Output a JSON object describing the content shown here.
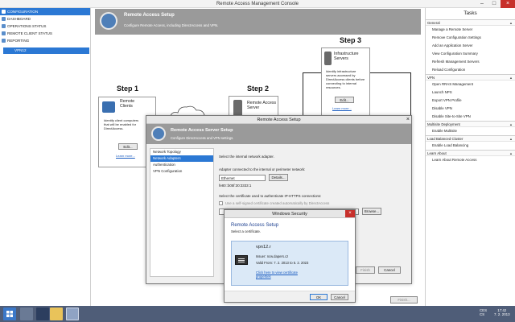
{
  "window": {
    "title": "Remote Access Management Console",
    "min": "–",
    "max": "□",
    "close": "×"
  },
  "nav": {
    "items": [
      {
        "label": "CONFIGURATION",
        "selected": true
      },
      {
        "label": "DASHBOARD"
      },
      {
        "label": "OPERATIONS STATUS"
      },
      {
        "label": "REMOTE CLIENT STATUS"
      },
      {
        "label": "REPORTING"
      }
    ],
    "server": "VPN12"
  },
  "header": {
    "title": "Remote Access Setup",
    "subtitle": "Configure Remote Access, including DirectAccess and VPN."
  },
  "steps": {
    "step1": {
      "label": "Step 1",
      "title_l1": "Remote",
      "title_l2": "Clients",
      "desc_l1": "Identify client computers",
      "desc_l2": "that will be enabled for",
      "desc_l3": "DirectAccess.",
      "edit": "Edit...",
      "learn": "Learn more..."
    },
    "step2": {
      "label": "Step 2",
      "title_l1": "Remote Access",
      "title_l2": "Server"
    },
    "step3": {
      "label": "Step 3",
      "title_l1": "Infrastructure",
      "title_l2": "Servers",
      "desc_l1": "Identify infrastructure",
      "desc_l2": "servers accessed by",
      "desc_l3": "DirectAccess clients before",
      "desc_l4": "connecting to internal",
      "desc_l5": "resources.",
      "edit": "Edit...",
      "learn": "Learn more..."
    }
  },
  "tasks": {
    "title": "Tasks",
    "sections": [
      {
        "name": "General",
        "items": [
          "Manage a Remote Server",
          "Remove Configuration Settings",
          "Add an Application Server",
          "View Configuration Summary",
          "Refresh Management Servers",
          "Reload Configuration"
        ]
      },
      {
        "name": "VPN",
        "items": [
          "Open RRAS Management",
          "Launch NPS",
          "Export VPN Profile",
          "Disable VPN",
          "Disable Site-to-Site VPN"
        ]
      },
      {
        "name": "Multisite Deployment",
        "items": [
          "Enable Multisite"
        ]
      },
      {
        "name": "Load Balanced Cluster",
        "items": [
          "Enable Load Balancing"
        ]
      },
      {
        "name": "Learn About",
        "items": [
          "Learn About Remote Access"
        ]
      }
    ]
  },
  "setup": {
    "title": "Remote Access Setup",
    "header_title": "Remote Access Server Setup",
    "header_sub": "Configure DirectAccess and VPN settings.",
    "nav": [
      "Network Topology",
      "Network Adapters",
      "Authentication",
      "VPN Configuration"
    ],
    "select_label": "Select the internal network adapter.",
    "adapter_label": "Adapter connected to the internal or perimeter network:",
    "adapter_value": "Ethernet",
    "details": "Details...",
    "ip": "fe80::b05f:30:3333:1",
    "cert_label": "Select the certificate used to authenticate IP-HTTPS connections:",
    "selfsigned": "Use a self-signed certificate created automatically by DirectAccess",
    "browse": "Browse...",
    "finish": "Finish",
    "cancel": "Cancel"
  },
  "security": {
    "title": "Windows Security",
    "heading": "Remote Access Setup",
    "sub": "Select a certificate.",
    "cert_name": "vpn12.r",
    "issuer": "Issuer: ncw.dapers.cz",
    "valid": "Valid From: 7. 2. 2013 to 5. 2. 2023",
    "link_l1": "Click here to view certificate",
    "link_l2": "properties",
    "ok": "OK",
    "cancel": "Cancel"
  },
  "background_finish": "Finish...",
  "taskbar": {
    "lang": "CES",
    "lang2": "CS",
    "time": "17:42",
    "date": "7. 2. 2013"
  },
  "colors": {
    "accent": "#2b78d4",
    "header_gray": "#9a9a9a",
    "taskbar": "#4f5d78",
    "close_red": "#c7302b"
  }
}
